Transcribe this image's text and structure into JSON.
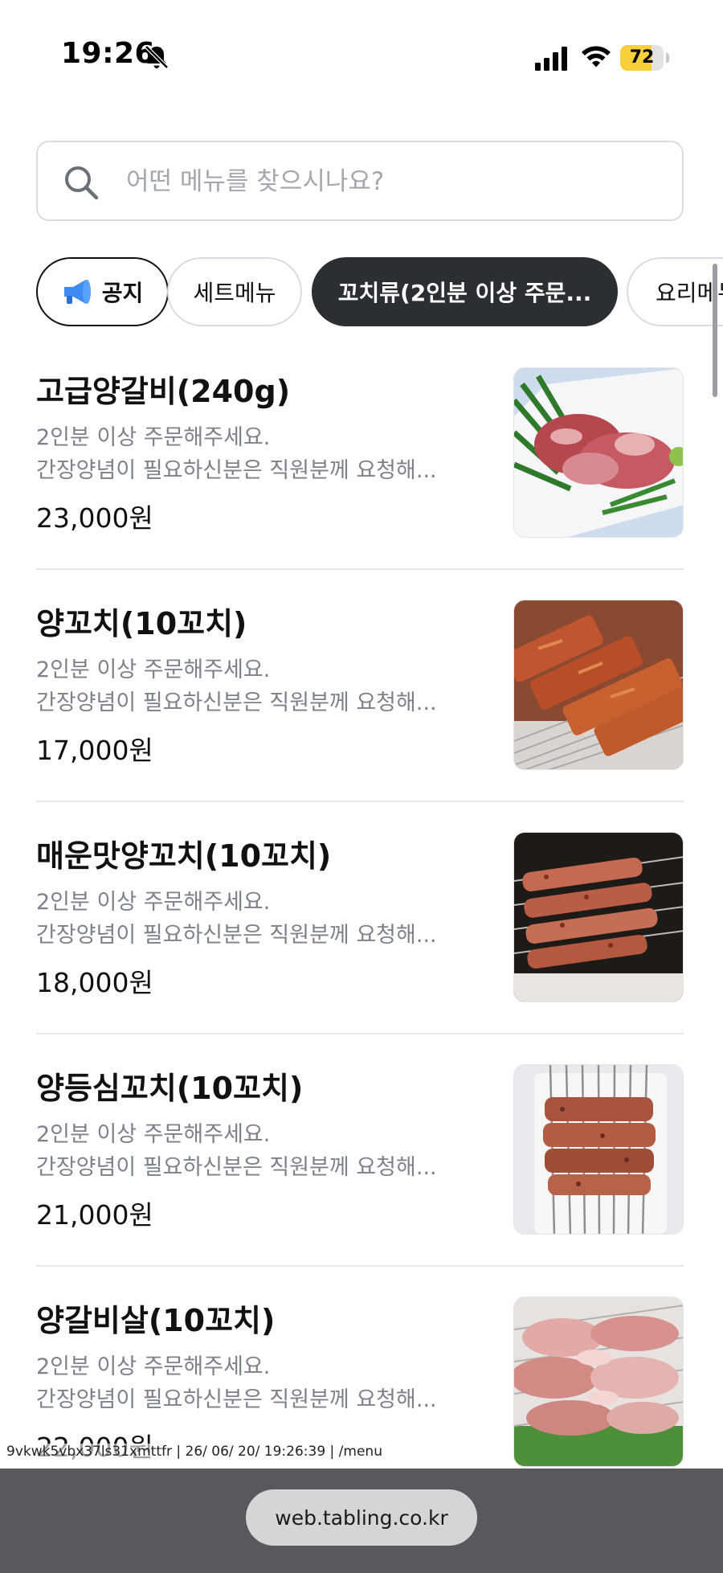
{
  "status_bar": {
    "time": "19:26",
    "battery": "72",
    "battery_level": 0.72,
    "colors": {
      "battery_fill": "#f6cf3a"
    }
  },
  "search": {
    "placeholder": "어떤 메뉴를 찾으시나요?",
    "value": ""
  },
  "categories": [
    {
      "label": "공지",
      "icon": "megaphone-icon",
      "selected": false
    },
    {
      "label": "세트메뉴",
      "selected": false
    },
    {
      "label": "꼬치류(2인분 이상 주문...",
      "selected": true
    },
    {
      "label": "요리메뉴",
      "selected": false
    }
  ],
  "menu_items": [
    {
      "name": "고급양갈비(240g)",
      "desc_line1": "2인분 이상 주문해주세요.",
      "desc_line2": "간장양념이 필요하신분은 직원분께 요청해...",
      "price": "23,000원",
      "image": "lamb-ribs-photo"
    },
    {
      "name": "양꼬치(10꼬치)",
      "desc_line1": "2인분 이상 주문해주세요.",
      "desc_line2": "간장양념이 필요하신분은 직원분께 요청해...",
      "price": "17,000원",
      "image": "lamb-skewers-photo"
    },
    {
      "name": "매운맛양꼬치(10꼬치)",
      "desc_line1": "2인분 이상 주문해주세요.",
      "desc_line2": "간장양념이 필요하신분은 직원분께 요청해...",
      "price": "18,000원",
      "image": "spicy-lamb-skewers-photo"
    },
    {
      "name": "양등심꼬치(10꼬치)",
      "desc_line1": "2인분 이상 주문해주세요.",
      "desc_line2": "간장양념이 필요하신분은 직원분께 요청해...",
      "price": "21,000원",
      "image": "lamb-loin-skewers-photo"
    },
    {
      "name": "양갈비살(10꼬치)",
      "desc_line1": "2인분 이상 주문해주세요.",
      "desc_line2": "간장양념이 필요하신분은 직원분께 요청해...",
      "price": "22,000원",
      "image": "lamb-rib-meat-skewers-photo"
    }
  ],
  "debug_text": "9vkwk5vbx37ls31xmttfr | 26/ 06/ 20/ 19:26:39 | /menu",
  "browser": {
    "url": "web.tabling.co.kr"
  },
  "colors": {
    "active_chip": "#2b2f33",
    "desc_text": "#7c818a",
    "divider": "#e6e8eb",
    "browser_bar": "#57595c"
  }
}
